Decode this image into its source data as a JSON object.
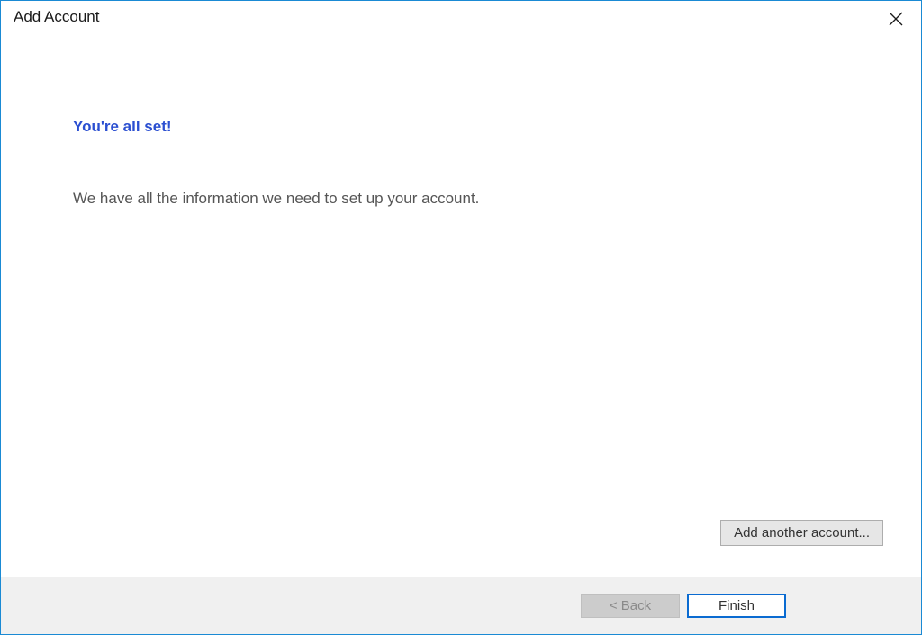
{
  "window": {
    "title": "Add Account"
  },
  "content": {
    "headline": "You're all set!",
    "body": "We have all the information we need to set up your account."
  },
  "buttons": {
    "add_another": "Add another account...",
    "back": "< Back",
    "finish": "Finish"
  }
}
